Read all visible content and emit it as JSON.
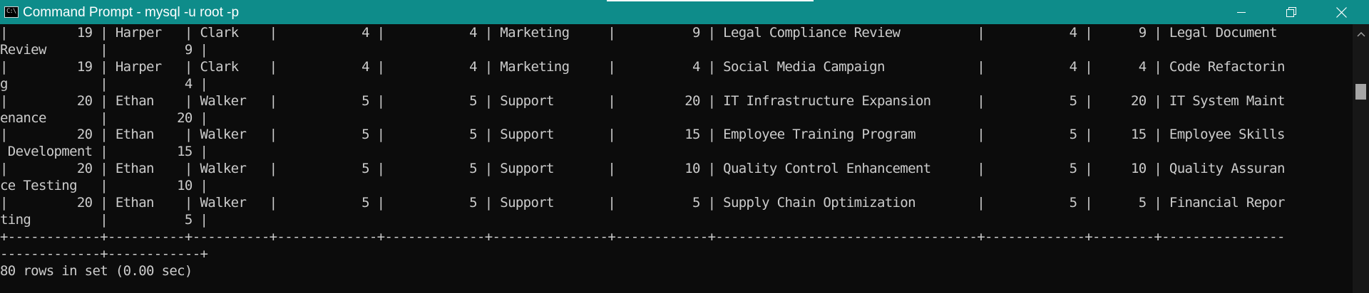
{
  "window": {
    "title": "Command Prompt - mysql  -u root -p",
    "app_icon_text": "C:\\",
    "controls": [
      "minimize-icon",
      "maximize-icon",
      "close-icon"
    ],
    "colors": {
      "titlebar": "#0e8c8a",
      "console_bg": "#0c0c0c",
      "console_text": "#cccccc",
      "scrollbar_thumb": "#a6a6a6"
    }
  },
  "console": {
    "lines": [
      "|         19 | Harper   | Clark    |           4 |           4 | Marketing     |          9 | Legal Compliance Review          |           4 |      9 | Legal Document",
      "Review       |          9 |",
      "|         19 | Harper   | Clark    |           4 |           4 | Marketing     |          4 | Social Media Campaign            |           4 |      4 | Code Refactorin",
      "g            |          4 |",
      "|         20 | Ethan    | Walker   |           5 |           5 | Support       |         20 | IT Infrastructure Expansion      |           5 |     20 | IT System Maint",
      "enance       |         20 |",
      "|         20 | Ethan    | Walker   |           5 |           5 | Support       |         15 | Employee Training Program        |           5 |     15 | Employee Skills",
      " Development |         15 |",
      "|         20 | Ethan    | Walker   |           5 |           5 | Support       |         10 | Quality Control Enhancement      |           5 |     10 | Quality Assuran",
      "ce Testing   |         10 |",
      "|         20 | Ethan    | Walker   |           5 |           5 | Support       |          5 | Supply Chain Optimization        |           5 |      5 | Financial Repor",
      "ting         |          5 |",
      "+------------+----------+----------+-------------+-------------+---------------+------------+----------------------------------+-------------+--------+----------------",
      "-------------+------------+",
      "80 rows in set (0.00 sec)"
    ]
  }
}
